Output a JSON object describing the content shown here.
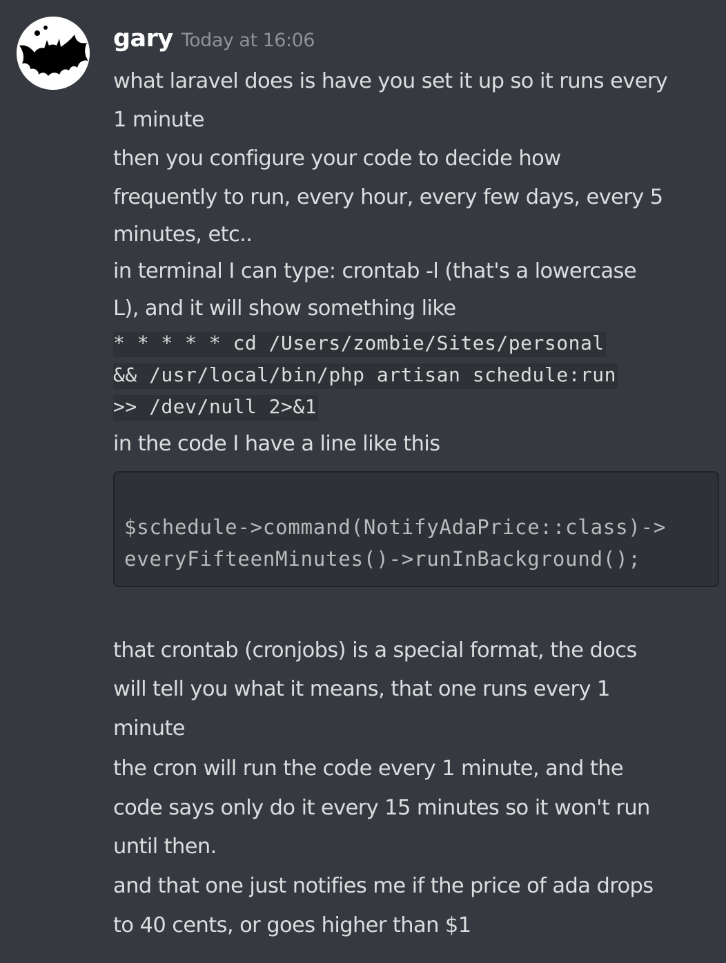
{
  "message": {
    "author": "gary",
    "timestamp": "Today at 16:06",
    "avatar_icon": "bat-icon",
    "lines_1": [
      "what laravel does is have you set it up so it runs every",
      "1 minute",
      "then you configure your code to decide how",
      "frequently to run, every hour, every few days, every 5",
      "minutes, etc..",
      "in terminal I can type: crontab -l (that's a lowercase",
      "L), and it will show something like"
    ],
    "inline_code": [
      "* * * * * cd /Users/zombie/Sites/personal",
      "&& /usr/local/bin/php artisan schedule:run",
      ">> /dev/null 2>&1"
    ],
    "lines_2": [
      "in the code I have a line like this"
    ],
    "code_block": [
      "$schedule->command(NotifyAdaPrice::class)->",
      "everyFifteenMinutes()->runInBackground();"
    ],
    "lines_3": [
      "that crontab (cronjobs) is a special format, the docs",
      "will tell you what it means, that one runs every 1",
      "minute",
      "the cron will run the code every 1 minute, and the",
      "code says only do it every 15 minutes so it won't run",
      "until then.",
      "and that one just notifies me if the price of ada drops",
      "to 40 cents, or goes higher than $1"
    ]
  },
  "colors": {
    "background": "#36393f",
    "text": "#dcddde",
    "username": "#ffffff",
    "timestamp": "#8e9297",
    "code_background": "#2f3136"
  }
}
